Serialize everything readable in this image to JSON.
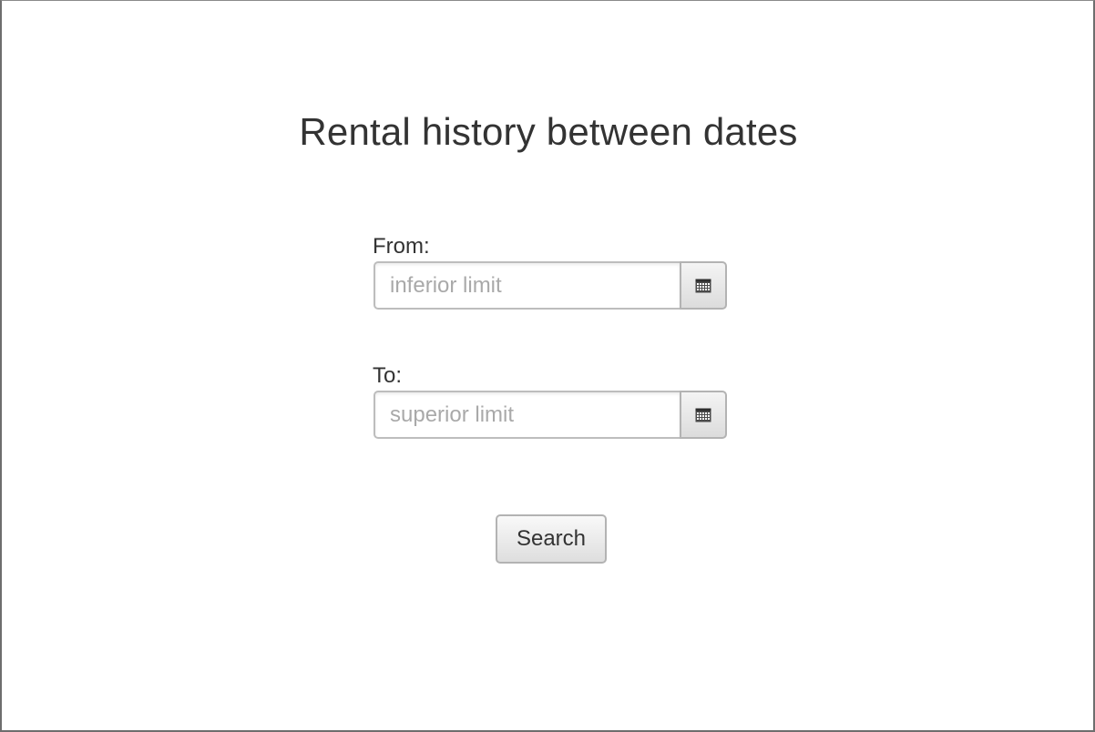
{
  "page": {
    "title": "Rental history between dates"
  },
  "form": {
    "from": {
      "label": "From:",
      "value": "",
      "placeholder": "inferior limit",
      "icon": "calendar-icon"
    },
    "to": {
      "label": "To:",
      "value": "",
      "placeholder": "superior limit",
      "icon": "calendar-icon"
    },
    "search_label": "Search"
  },
  "colors": {
    "text": "#333333",
    "placeholder": "#a9a9a9",
    "border": "#bdbdbd",
    "button_top": "#f9f9f9",
    "button_bottom": "#dedede"
  }
}
